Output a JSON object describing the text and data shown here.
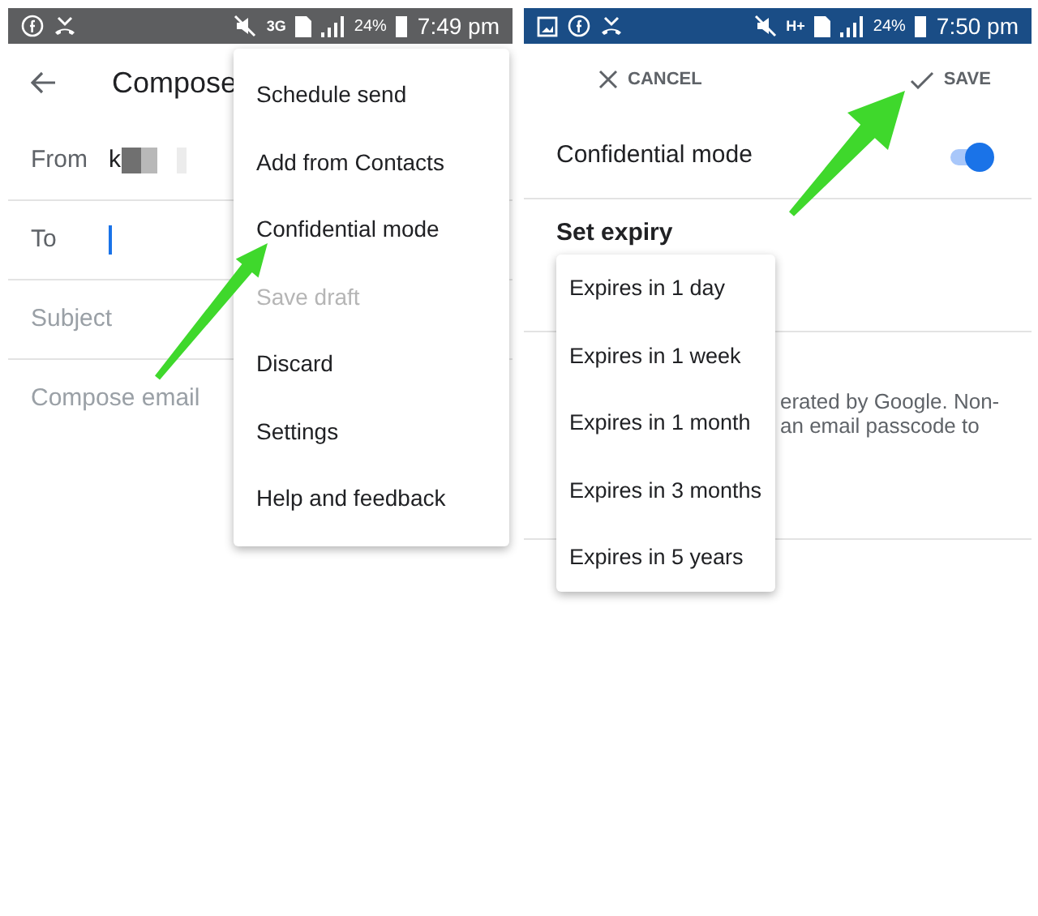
{
  "compose_screen": {
    "status_bar": {
      "network": "3G",
      "battery": "24%",
      "time": "7:49 pm"
    },
    "title": "Compose",
    "from": {
      "label": "From",
      "value": "k"
    },
    "to": {
      "label": "To"
    },
    "subject": {
      "placeholder": "Subject"
    },
    "body": {
      "placeholder": "Compose email"
    },
    "overflow_menu": [
      {
        "label": "Schedule send",
        "disabled": false
      },
      {
        "label": "Add from Contacts",
        "disabled": false
      },
      {
        "label": "Confidential mode",
        "disabled": false
      },
      {
        "label": "Save draft",
        "disabled": true
      },
      {
        "label": "Discard",
        "disabled": false
      },
      {
        "label": "Settings",
        "disabled": false
      },
      {
        "label": "Help and feedback",
        "disabled": false
      }
    ]
  },
  "confidential_screen": {
    "status_bar": {
      "network": "H+",
      "battery": "24%",
      "time": "7:50 pm"
    },
    "cancel_button": "CANCEL",
    "save_button": "SAVE",
    "confidential_mode": {
      "label": "Confidential mode",
      "on": true
    },
    "set_expiry": "Set expiry",
    "description_fragments": [
      "erated by Google. Non-",
      "an email passcode to"
    ],
    "expiry_menu": [
      "Expires in 1 day",
      "Expires in 1 week",
      "Expires in 1 month",
      "Expires in 3 months",
      "Expires in 5 years"
    ]
  }
}
